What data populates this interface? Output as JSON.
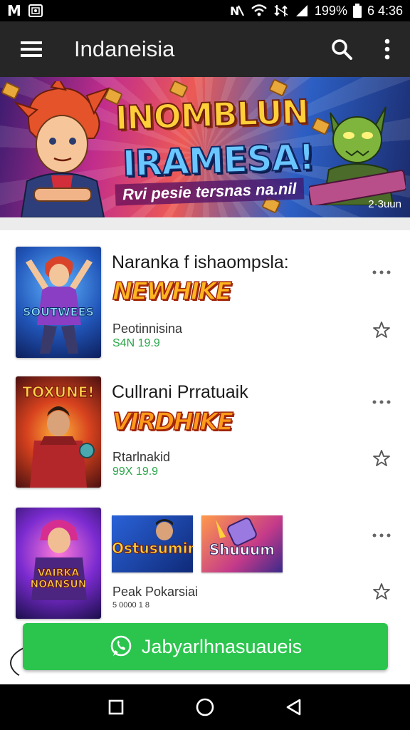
{
  "status_bar": {
    "left_icons": [
      "M",
      "photo-icon"
    ],
    "battery": "199%",
    "time": "6 4:36"
  },
  "app_bar": {
    "title": "Indaneisia"
  },
  "banner": {
    "title_line1": "INOMBLUN",
    "title_line2": "IRAMESA!",
    "tagline": "Rvi pesie tersnas na.nil",
    "corner_text": "2·3uun"
  },
  "items": [
    {
      "title": "Naranka f ishaompsla:",
      "badge": "NEWHIKE",
      "thumb_text": "SOUTWEES",
      "subtitle": "Peotinnisina",
      "price": "S4N 19.9"
    },
    {
      "title": "Cullrani Prratuaik",
      "badge": "VIRDHIKE",
      "thumb_text": "TOXUNE!",
      "subtitle": "Rtarlnakid",
      "price": "99X 19.9"
    },
    {
      "title": "",
      "badge": "",
      "thumb_text": "VAIRKA NOANSUN",
      "subtitle": "Peak Pokarsiai",
      "price": "5 0000 1 8",
      "mini_thumbs": [
        "Ostusumin",
        "Shuuum"
      ]
    }
  ],
  "cta": {
    "label": "Jabyarlhnasuaueis"
  },
  "colors": {
    "app_bar": "#262626",
    "accent_green": "#2bc54e",
    "price_green": "#2aa64a"
  }
}
